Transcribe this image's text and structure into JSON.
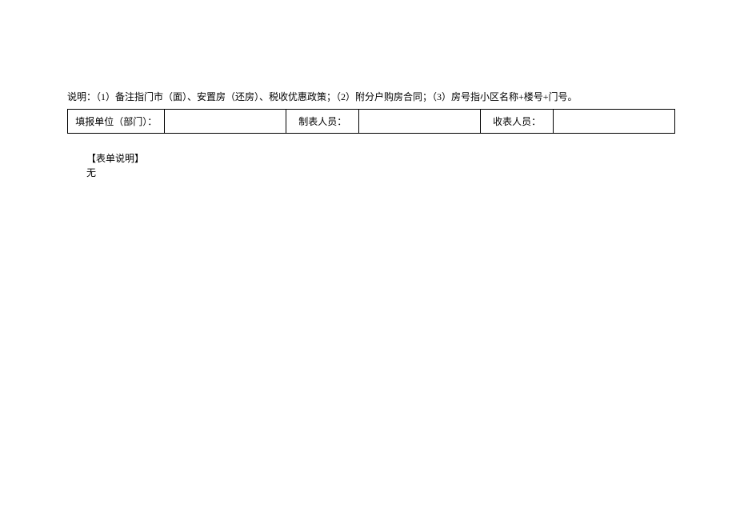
{
  "explanation": "说明：（1）备注指门市（面）、安置房（还房）、税收优惠政策；（2）附分户购房合同；（3）房号指小区名称+楼号+门号。",
  "fields": {
    "reporting_unit_label": "填报单位（部门）：",
    "reporting_unit_value": "",
    "preparer_label": "制表人员：",
    "preparer_value": "",
    "receiver_label": "收表人员：",
    "receiver_value": ""
  },
  "section": {
    "heading": "【表单说明】",
    "body": "无"
  }
}
